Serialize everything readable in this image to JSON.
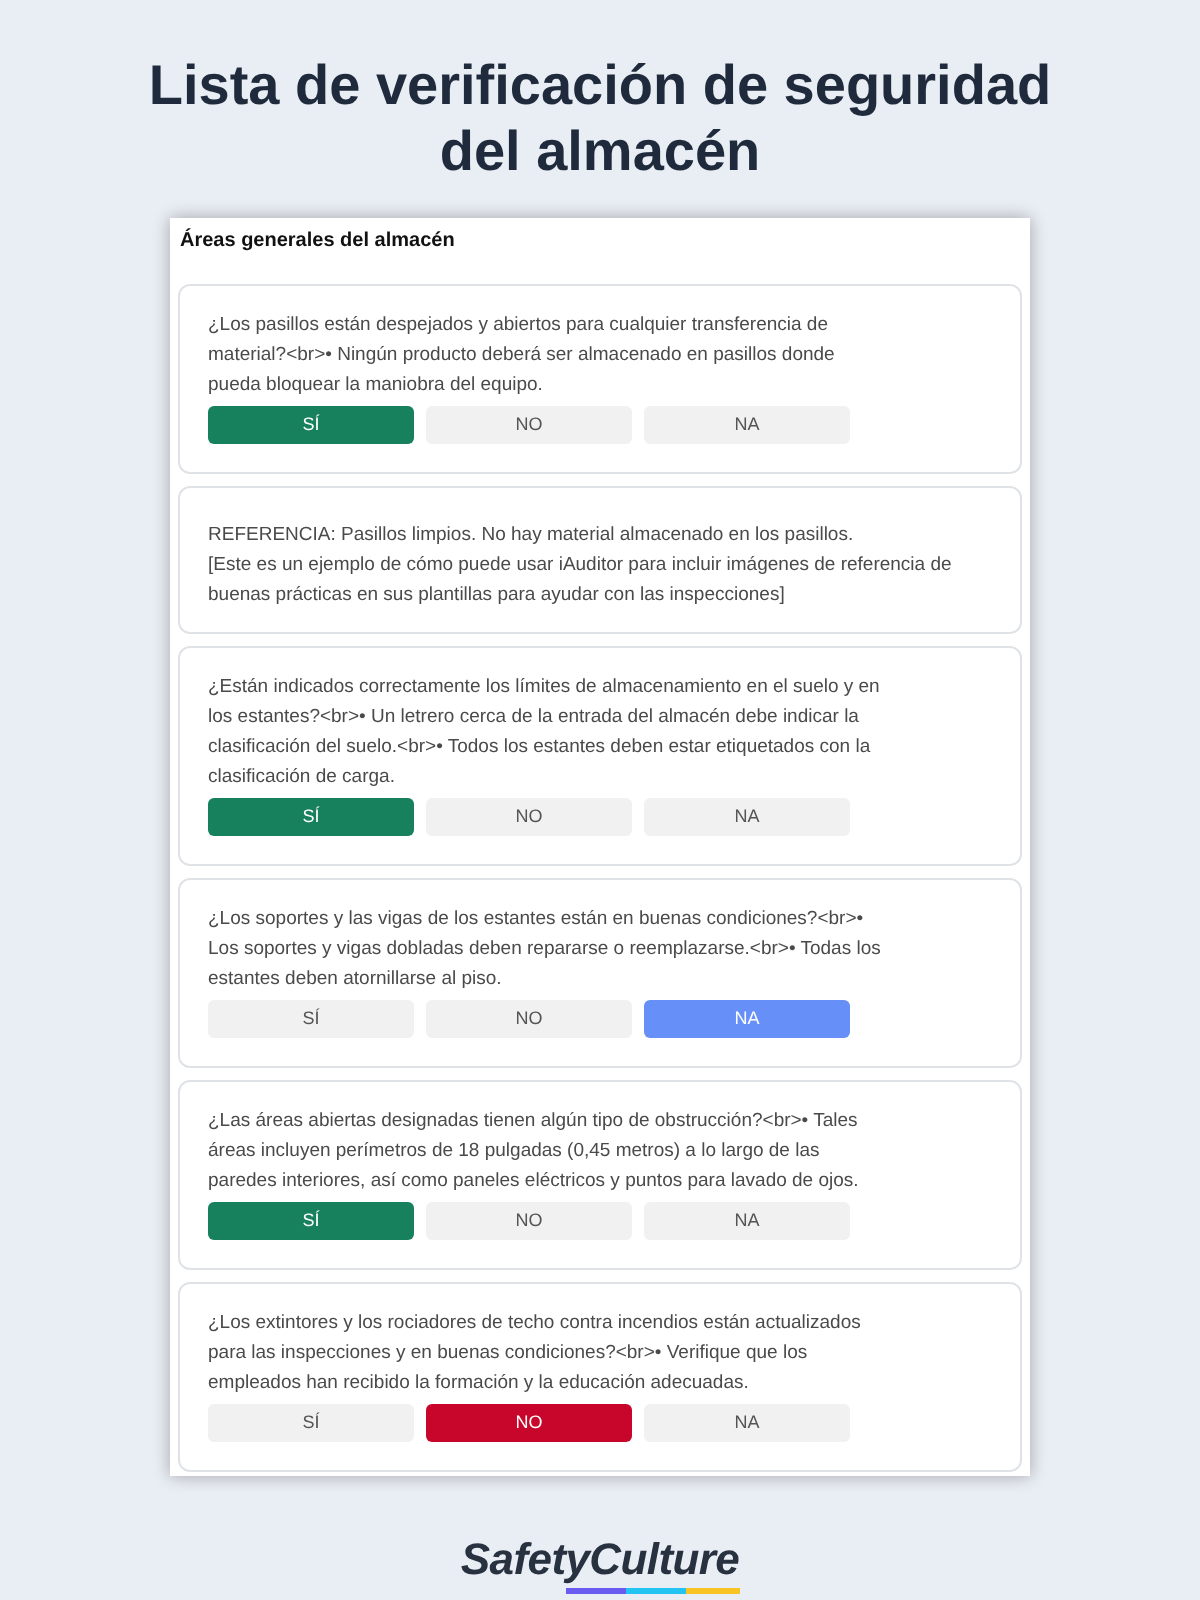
{
  "title": "Lista de verificación de seguridad del almacén",
  "panel": {
    "section_title": "Áreas generales del almacén",
    "items": [
      {
        "kind": "question",
        "text": "¿Los pasillos están despejados y abiertos para cualquier transferencia de material?<br>• Ningún producto deberá ser almacenado en pasillos donde pueda bloquear la maniobra del equipo.",
        "options": [
          {
            "label": "SÍ",
            "selected": true
          },
          {
            "label": "NO",
            "selected": false
          },
          {
            "label": "NA",
            "selected": false
          }
        ]
      },
      {
        "kind": "note",
        "lines": [
          "REFERENCIA: Pasillos limpios. No hay material almacenado en los pasillos.",
          "[Este es un ejemplo de cómo puede usar iAuditor para incluir imágenes de referencia de buenas prácticas en sus plantillas para ayudar con las inspecciones]"
        ]
      },
      {
        "kind": "question",
        "text": "¿Están indicados correctamente los límites de almacenamiento en el suelo y en los estantes?<br>• Un letrero cerca de la entrada del almacén debe indicar la clasificación del suelo.<br>• Todos los estantes deben estar etiquetados con la clasificación de carga.",
        "options": [
          {
            "label": "SÍ",
            "selected": true
          },
          {
            "label": "NO",
            "selected": false
          },
          {
            "label": "NA",
            "selected": false
          }
        ]
      },
      {
        "kind": "question",
        "text": "¿Los soportes y las vigas de los estantes están en buenas condiciones?<br>• Los soportes y vigas dobladas deben repararse o reemplazarse.<br>• Todas los estantes deben atornillarse al piso.",
        "options": [
          {
            "label": "SÍ",
            "selected": false
          },
          {
            "label": "NO",
            "selected": false
          },
          {
            "label": "NA",
            "selected": true
          }
        ]
      },
      {
        "kind": "question",
        "text": "¿Las áreas abiertas designadas tienen algún tipo de obstrucción?<br>• Tales áreas incluyen perímetros de 18 pulgadas (0,45 metros) a lo largo de las paredes interiores, así como paneles eléctricos y puntos para lavado de ojos.",
        "options": [
          {
            "label": "SÍ",
            "selected": true
          },
          {
            "label": "NO",
            "selected": false
          },
          {
            "label": "NA",
            "selected": false
          }
        ]
      },
      {
        "kind": "question",
        "text": "¿Los extintores y los rociadores de techo contra incendios están actualizados para las inspecciones y en buenas condiciones?<br>• Verifique que los empleados han recibido la formación y la educación adecuadas.",
        "options": [
          {
            "label": "SÍ",
            "selected": false
          },
          {
            "label": "NO",
            "selected": true
          },
          {
            "label": "NA",
            "selected": false
          }
        ]
      }
    ]
  },
  "logo": {
    "text": "SafetyCulture"
  }
}
